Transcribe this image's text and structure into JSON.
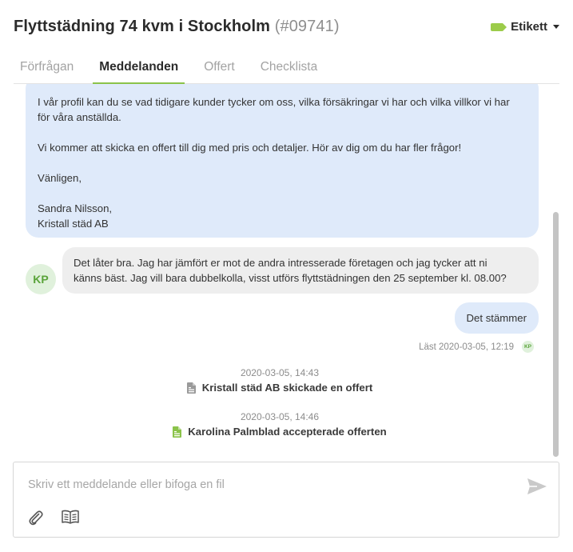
{
  "header": {
    "title": "Flyttstädning 74 kvm i Stockholm",
    "ref": "(#09741)",
    "label_button": "Etikett"
  },
  "tabs": [
    {
      "label": "Förfrågan",
      "active": false
    },
    {
      "label": "Meddelanden",
      "active": true
    },
    {
      "label": "Offert",
      "active": false
    },
    {
      "label": "Checklista",
      "active": false
    }
  ],
  "messages": {
    "agent": {
      "line1": "I vår profil kan du se vad tidigare kunder tycker om oss, vilka försäkringar vi har och vilka villkor vi har",
      "line2": "för våra anställda.",
      "line3": "Vi kommer att skicka en offert till dig med pris och detaljer. Hör av dig om du har fler frågor!",
      "line4": "Vänligen,",
      "line5": "Sandra Nilsson,",
      "line6": "Kristall städ AB"
    },
    "client": {
      "avatar": "KP",
      "line1": "Det låter bra. Jag har jämfört er mot de andra intresserade företagen och jag tycker att ni",
      "line2": "känns bäst. Jag vill bara dubbelkolla, visst utförs flyttstädningen den 25 september kl. 08.00?"
    },
    "reply": {
      "text": "Det stämmer",
      "read_receipt": "Läst 2020-03-05, 12:19",
      "read_avatar": "KP"
    }
  },
  "events": [
    {
      "time": "2020-03-05, 14:43",
      "text": "Kristall städ AB skickade en offert",
      "icon": "document-icon",
      "color": "#9a9a9a"
    },
    {
      "time": "2020-03-05, 14:46",
      "text": "Karolina Palmblad accepterade offerten",
      "icon": "document-accepted-icon",
      "color": "#8bc34a"
    }
  ],
  "composer": {
    "placeholder": "Skriv ett meddelande eller bifoga en fil"
  },
  "colors": {
    "accent": "#8bc34a",
    "agent_bubble": "#dfeafa",
    "client_bubble": "#eeeeee"
  }
}
